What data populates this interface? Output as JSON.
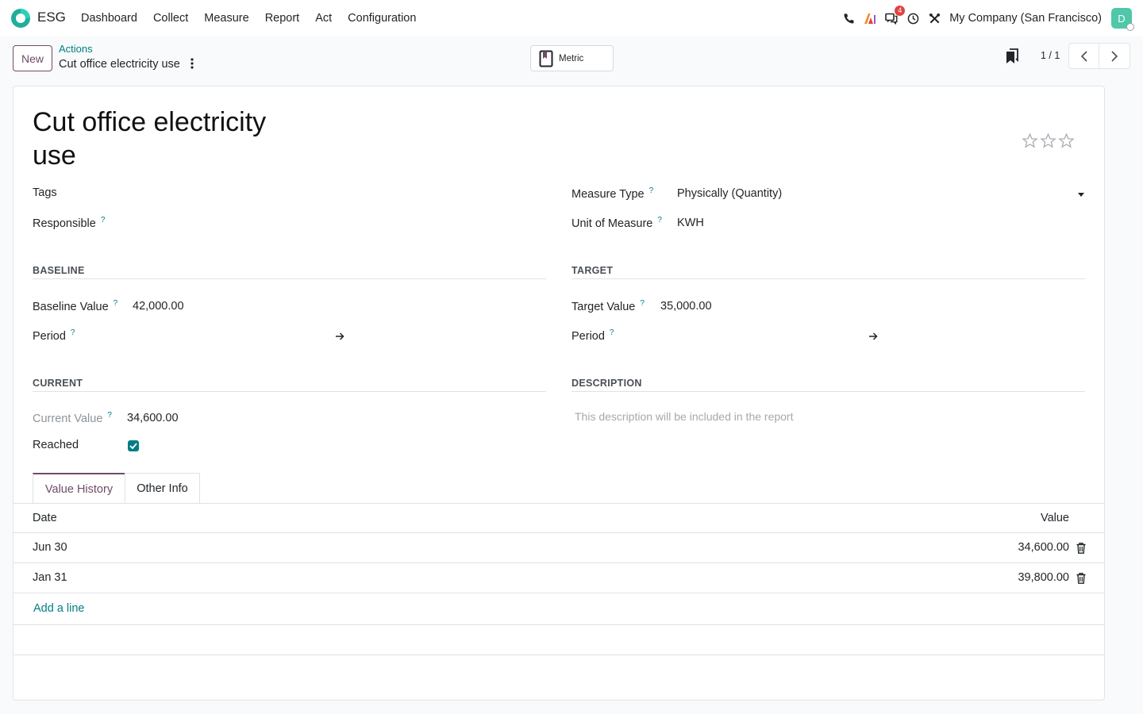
{
  "app": {
    "name": "ESG",
    "menu": [
      "Dashboard",
      "Collect",
      "Measure",
      "Report",
      "Act",
      "Configuration"
    ],
    "company": "My Company (San Francisco)",
    "avatar_initial": "D",
    "messages_badge": "4",
    "brand_color": "#714b67",
    "accent_color": "#017e84"
  },
  "control": {
    "new_label": "New",
    "breadcrumb_parent": "Actions",
    "breadcrumb_current": "Cut office electricity use",
    "smart_button_label": "Metric",
    "pager": "1 / 1"
  },
  "form": {
    "title": "Cut office electricity use",
    "tags_label": "Tags",
    "responsible_label": "Responsible",
    "measure_type_label": "Measure Type",
    "measure_type_value": "Physically (Quantity)",
    "uom_label": "Unit of Measure",
    "uom_value": "KWH",
    "baseline": {
      "title": "BASELINE",
      "value_label": "Baseline Value",
      "value": "42,000.00",
      "period_label": "Period"
    },
    "target": {
      "title": "TARGET",
      "value_label": "Target Value",
      "value": "35,000.00",
      "period_label": "Period"
    },
    "current": {
      "title": "CURRENT",
      "value_label": "Current Value",
      "value": "34,600.00",
      "reached_label": "Reached",
      "reached": true
    },
    "description": {
      "title": "DESCRIPTION",
      "placeholder": "This description will be included in the report"
    },
    "priority_stars": 0
  },
  "tabs": [
    "Value History",
    "Other Info"
  ],
  "history": {
    "columns": [
      "Date",
      "Value"
    ],
    "rows": [
      {
        "date": "Jun 30",
        "value": "34,600.00"
      },
      {
        "date": "Jan 31",
        "value": "39,800.00"
      }
    ],
    "add_line_label": "Add a line"
  }
}
